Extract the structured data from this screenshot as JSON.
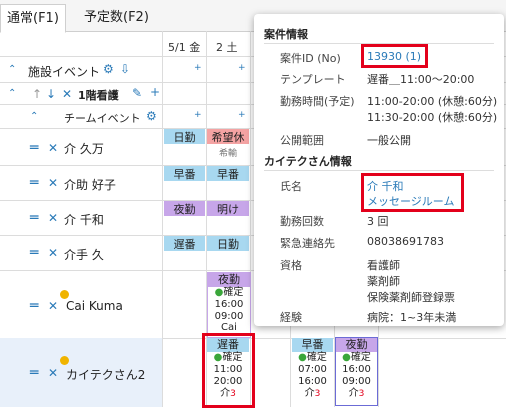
{
  "tabs": [
    {
      "label": "通常(F1)"
    },
    {
      "label": "予定数(F2)"
    }
  ],
  "header": {
    "date1": "5/1 金",
    "date2": "2 土"
  },
  "rows": {
    "facility_event": "施設イベント",
    "group": "1階看護",
    "team_event": "チームイベント",
    "staff": [
      {
        "name": "介 久万"
      },
      {
        "name": "介助 好子"
      },
      {
        "name": "介 千和"
      },
      {
        "name": "介手 久"
      },
      {
        "name": "Cai Kuma"
      },
      {
        "name": "カイテクさん2"
      }
    ]
  },
  "cells": {
    "r1c1": "日勤",
    "r1c2": "希望休",
    "r1c2sub": "希輸",
    "r2c1": "早番",
    "r2c2": "早番",
    "r3c1": "夜勤",
    "r3c2": "明け",
    "r4c1": "遅番",
    "r4c2": "日勤"
  },
  "cai_card": {
    "title": "夜勤",
    "status": "確定",
    "t1": "16:00",
    "t2": "09:00",
    "who": "Cai"
  },
  "kaitek_cards": [
    {
      "title": "遅番",
      "status": "確定",
      "t1": "11:00",
      "t2": "20:00",
      "who": "介",
      "count": "3"
    },
    {
      "title": "早番",
      "status": "確定",
      "t1": "07:00",
      "t2": "16:00",
      "who": "介",
      "count": "3"
    },
    {
      "title": "夜勤",
      "status": "確定",
      "t1": "16:00",
      "t2": "09:00",
      "who": "介",
      "count": "3"
    }
  ],
  "popup": {
    "case_section": "案件情報",
    "case_id_label": "案件ID (No)",
    "case_id_value": "13930 (1)",
    "template_label": "テンプレート",
    "template_value": "遅番＿11:00〜20:00",
    "hours_label": "勤務時間(予定)",
    "hours_value1": "11:00-20:00 (休憩:60分)",
    "hours_value2": "11:30-20:00 (休憩:60分)",
    "scope_label": "公開範囲",
    "scope_value": "一般公開",
    "worker_section": "カイテクさん情報",
    "name_label": "氏名",
    "name_value": "介 千和",
    "message_link": "メッセージルーム",
    "count_label": "勤務回数",
    "count_value": "3 回",
    "emergency_label": "緊急連絡先",
    "emergency_value": "08038691783",
    "qual_label": "資格",
    "qual1": "看護師",
    "qual2": "薬剤師",
    "qual3": "保険薬剤師登録票",
    "exp_label": "経験",
    "exp_value": "病院：1~3年未満"
  },
  "colors": {
    "accent": "#2a7ab8",
    "highlight": "#e3001b",
    "day": "#a8d8f0",
    "off": "#f4a3a3",
    "night": "#c7a6e9"
  }
}
